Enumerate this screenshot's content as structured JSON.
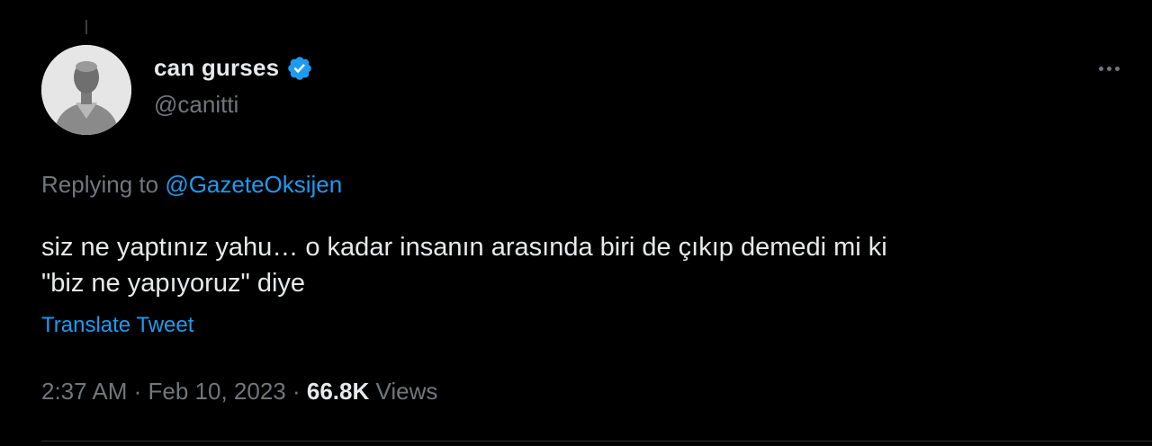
{
  "author": {
    "display_name": "can gurses",
    "handle": "@canitti",
    "verified": true
  },
  "reply": {
    "prefix": "Replying to ",
    "mention": "@GazeteOksijen"
  },
  "tweet": {
    "text_line1": "siz ne yaptınız yahu… o kadar insanın arasında biri de çıkıp demedi mi ki",
    "text_line2": "\"biz ne yapıyoruz\" diye",
    "translate_label": "Translate Tweet"
  },
  "meta": {
    "time": "2:37 AM",
    "separator": " · ",
    "date": "Feb 10, 2023",
    "views_count": "66.8K",
    "views_label": "Views"
  },
  "icons": {
    "verified": "verified-badge-icon",
    "more": "more-options-icon"
  },
  "colors": {
    "background": "#000000",
    "text_primary": "#e7e9ea",
    "text_secondary": "#71767b",
    "accent": "#1d9bf0"
  }
}
